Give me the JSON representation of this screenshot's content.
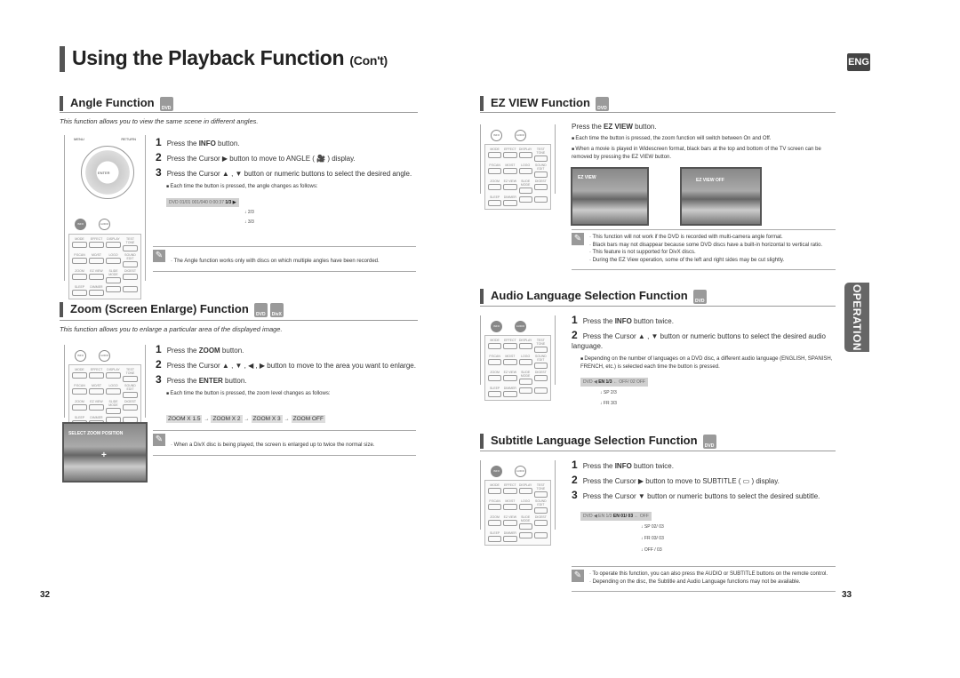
{
  "header": {
    "title": "Using the Playback Function",
    "title_suffix": "(Con't)",
    "lang_badge": "ENG",
    "side_tab": "OPERATION"
  },
  "disc_labels": {
    "dvd": "DVD",
    "divx": "DivX"
  },
  "remote": {
    "top_buttons": [
      "INFO",
      "AUDIO",
      "SUB"
    ],
    "nav": {
      "menu": "MENU",
      "return": "RETURN",
      "enter": "ENTER"
    },
    "grid": [
      "MODE",
      "EFFECT",
      "DISPLAY",
      "TEST TONE",
      "P.SCAN",
      "MO/ST",
      "LOGO",
      "SOUND EDIT",
      "ZOOM",
      "EZ VIEW",
      "SLIDE MODE",
      "DIGEST",
      "SLEEP",
      "DIMMER",
      "",
      ""
    ]
  },
  "angle": {
    "title": "Angle Function",
    "description": "This function allows you to view the same scene in different angles.",
    "steps": [
      {
        "n": "1",
        "pre": "Press the ",
        "bold": "INFO",
        "post": " button."
      },
      {
        "n": "2",
        "pre": "Press the Cursor ▶ button to move to ANGLE ( ",
        "bold": "🎥",
        "post": " ) display."
      },
      {
        "n": "3",
        "pre": "Press the Cursor ▲ , ▼ button or numeric buttons to select the desired angle.",
        "bold": "",
        "post": ""
      }
    ],
    "bullet": "Each time the button is pressed, the angle changes as follows:",
    "osd": "DVD  01/01  001/040  0:00:37",
    "osd_active": "1/3 ▶",
    "sequence": [
      "2/3",
      "3/3"
    ],
    "note": "· The Angle function works only with discs on which multiple angles have been recorded."
  },
  "zoom": {
    "title": "Zoom (Screen Enlarge) Function",
    "description": "This function allows you to enlarge a particular area of the displayed image.",
    "steps": [
      {
        "n": "1",
        "pre": "Press the ",
        "bold": "ZOOM",
        "post": " button."
      },
      {
        "n": "2",
        "pre": "Press the Cursor ▲ , ▼ , ◀ , ▶ button to move to the area you want to enlarge.",
        "bold": "",
        "post": ""
      },
      {
        "n": "3",
        "pre": "Press the ",
        "bold": "ENTER",
        "post": " button."
      }
    ],
    "bullet": "Each time the button is pressed, the zoom level changes as follows:",
    "levels": [
      "ZOOM X 1.5",
      "ZOOM X 2",
      "ZOOM X 3",
      "ZOOM OFF"
    ],
    "photo_label": "SELECT ZOOM POSITION",
    "note": "· When a DivX disc is being played, the screen is enlarged up to twice the normal size."
  },
  "ezview": {
    "title": "EZ VIEW Function",
    "instruction_pre": "Press the ",
    "instruction_bold": "EZ VIEW",
    "instruction_post": " button.",
    "bullets": [
      "Each time the button is pressed, the zoom function will switch between On and Off.",
      "When a movie is played in Widescreen format, black bars at the top and bottom of the TV screen can be removed by pressing the EZ VIEW button."
    ],
    "photo_on": "EZ VIEW",
    "photo_off": "EZ VIEW OFF",
    "notes": [
      "· This function will not work if the DVD is recorded with multi-camera angle format.",
      "· Black bars may not disappear because some DVD discs have a built-in horizontal to vertical ratio.",
      "· This feature is not supported for DivX discs.",
      "· During the EZ View operation, some of the left and right sides may be cut slightly."
    ]
  },
  "audio": {
    "title": "Audio Language Selection Function",
    "steps": [
      {
        "n": "1",
        "pre": "Press the ",
        "bold": "INFO",
        "post": " button twice."
      },
      {
        "n": "2",
        "pre": "Press the Cursor ▲ , ▼ button or numeric buttons to select the desired audio language.",
        "bold": "",
        "post": ""
      }
    ],
    "bullet": "Depending on the number of languages on a DVD disc, a different audio language (ENGLISH, SPANISH, FRENCH, etc.) is selected each time the button is pressed.",
    "osd_pre": "DVD ◀",
    "osd_active": "EN 1/3",
    "osd_post": "OFF/ 02   OFF",
    "sequence": [
      "SP 2/3",
      "FR 3/3"
    ]
  },
  "subtitle": {
    "title": "Subtitle Language Selection Function",
    "steps": [
      {
        "n": "1",
        "pre": "Press the ",
        "bold": "INFO",
        "post": " button twice."
      },
      {
        "n": "2",
        "pre": "Press the Cursor ▶ button to move to SUBTITLE ( ▭ ) display.",
        "bold": "",
        "post": ""
      },
      {
        "n": "3",
        "pre": "Press the Cursor ▼ button or numeric buttons to select the desired subtitle.",
        "bold": "",
        "post": ""
      }
    ],
    "osd_pre": "DVD ◀  EN 1/3",
    "osd_active": "EN 01/ 03",
    "osd_post": "OFF",
    "sequence": [
      "SP 02/ 03",
      "FR 03/ 03",
      "OFF / 03"
    ],
    "notes": [
      "· To operate this function, you can also press the AUDIO or SUBTITLE buttons on the remote control.",
      "· Depending on the disc, the Subtitle and Audio Language functions may not be available."
    ]
  },
  "page_numbers": {
    "left": "32",
    "right": "33"
  }
}
